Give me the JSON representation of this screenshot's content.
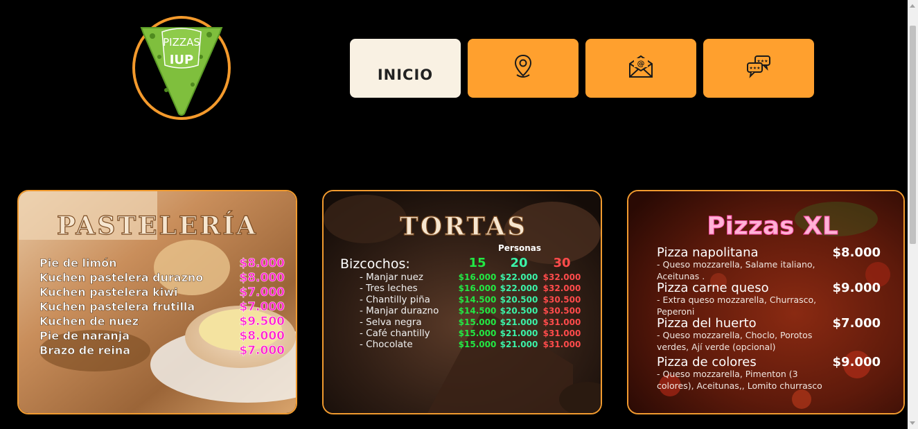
{
  "logo": {
    "line1": "PIZZAS",
    "line2": "IUP"
  },
  "nav": [
    {
      "id": "home",
      "label": "INICIO",
      "icon": "text"
    },
    {
      "id": "location",
      "label": "",
      "icon": "map-pin-icon"
    },
    {
      "id": "mail",
      "label": "",
      "icon": "envelope-at-icon"
    },
    {
      "id": "reviews",
      "label": "",
      "icon": "chat-rating-icon"
    }
  ],
  "colors": {
    "accent": "#ffa02e",
    "home_bg": "#f9f1e3",
    "border": "#f29b2f",
    "magenta": "#ff22cc",
    "green": "#22e844",
    "teal": "#3bf2a8",
    "red": "#ff4b4b",
    "pink": "#ff7fbf"
  },
  "pasteleria": {
    "title": "PASTELERÍA",
    "items": [
      {
        "name": "Pie de limón",
        "price": "$8.000"
      },
      {
        "name": "Kuchen pastelera durazno",
        "price": "$8.000"
      },
      {
        "name": "Kuchen pastelera kiwi",
        "price": "$7.000"
      },
      {
        "name": "Kuchen pastelera frutilla",
        "price": "$7.000"
      },
      {
        "name": "Kuchen de nuez",
        "price": "$9.500"
      },
      {
        "name": "Pie de naranja",
        "price": "$8.000"
      },
      {
        "name": "Brazo de reina",
        "price": "$7.000"
      }
    ]
  },
  "tortas": {
    "title": "TORTAS",
    "personas_label": "Personas",
    "section_label": "Bizcochos:",
    "sizes": [
      "15",
      "20",
      "30"
    ],
    "items": [
      {
        "name": "- Manjar nuez",
        "p15": "$16.000",
        "p20": "$22.000",
        "p30": "$32.000"
      },
      {
        "name": "- Tres leches",
        "p15": "$16.000",
        "p20": "$22.000",
        "p30": "$32.000"
      },
      {
        "name": "- Chantilly piña",
        "p15": "$14.500",
        "p20": "$20.500",
        "p30": "$30.500"
      },
      {
        "name": "- Manjar durazno",
        "p15": "$14.500",
        "p20": "$20.500",
        "p30": "$30.500"
      },
      {
        "name": "- Selva negra",
        "p15": "$15.000",
        "p20": "$21.000",
        "p30": "$31.000"
      },
      {
        "name": "- Café chantilly",
        "p15": "$15.000",
        "p20": "$21.000",
        "p30": "$31.000"
      },
      {
        "name": "- Chocolate",
        "p15": "$15.000",
        "p20": "$21.000",
        "p30": "$31.000"
      }
    ]
  },
  "pizzas": {
    "title": "Pizzas XL",
    "items": [
      {
        "name": "Pizza napolitana",
        "price": "$8.000",
        "desc1": "- Queso mozzarella, Salame italiano,",
        "desc2": "Aceitunas ."
      },
      {
        "name": "Pizza carne queso",
        "price": "$9.000",
        "desc1": "- Extra queso mozzarella, Churrasco,",
        "desc2": "Peperoni"
      },
      {
        "name": "Pizza del huerto",
        "price": "$7.000",
        "desc1": "- Queso mozzarella,  Choclo, Porotos",
        "desc2": "verdes, Ají verde (opcional)"
      },
      {
        "name": "Pizza de colores",
        "price": "$9.000",
        "desc1": "- Queso mozzarella, Pimenton (3",
        "desc2": "colores), Aceitunas,, Lomito churrasco"
      }
    ]
  }
}
